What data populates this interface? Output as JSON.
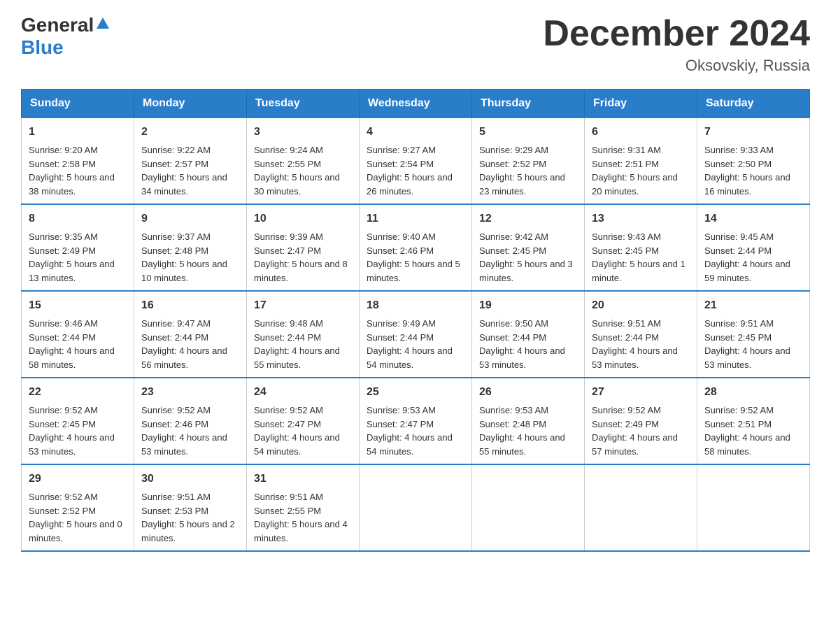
{
  "header": {
    "logo": {
      "general": "General",
      "blue": "Blue"
    },
    "title": "December 2024",
    "location": "Oksovskiy, Russia"
  },
  "weekdays": [
    "Sunday",
    "Monday",
    "Tuesday",
    "Wednesday",
    "Thursday",
    "Friday",
    "Saturday"
  ],
  "weeks": [
    [
      {
        "day": "1",
        "sunrise": "Sunrise: 9:20 AM",
        "sunset": "Sunset: 2:58 PM",
        "daylight": "Daylight: 5 hours and 38 minutes."
      },
      {
        "day": "2",
        "sunrise": "Sunrise: 9:22 AM",
        "sunset": "Sunset: 2:57 PM",
        "daylight": "Daylight: 5 hours and 34 minutes."
      },
      {
        "day": "3",
        "sunrise": "Sunrise: 9:24 AM",
        "sunset": "Sunset: 2:55 PM",
        "daylight": "Daylight: 5 hours and 30 minutes."
      },
      {
        "day": "4",
        "sunrise": "Sunrise: 9:27 AM",
        "sunset": "Sunset: 2:54 PM",
        "daylight": "Daylight: 5 hours and 26 minutes."
      },
      {
        "day": "5",
        "sunrise": "Sunrise: 9:29 AM",
        "sunset": "Sunset: 2:52 PM",
        "daylight": "Daylight: 5 hours and 23 minutes."
      },
      {
        "day": "6",
        "sunrise": "Sunrise: 9:31 AM",
        "sunset": "Sunset: 2:51 PM",
        "daylight": "Daylight: 5 hours and 20 minutes."
      },
      {
        "day": "7",
        "sunrise": "Sunrise: 9:33 AM",
        "sunset": "Sunset: 2:50 PM",
        "daylight": "Daylight: 5 hours and 16 minutes."
      }
    ],
    [
      {
        "day": "8",
        "sunrise": "Sunrise: 9:35 AM",
        "sunset": "Sunset: 2:49 PM",
        "daylight": "Daylight: 5 hours and 13 minutes."
      },
      {
        "day": "9",
        "sunrise": "Sunrise: 9:37 AM",
        "sunset": "Sunset: 2:48 PM",
        "daylight": "Daylight: 5 hours and 10 minutes."
      },
      {
        "day": "10",
        "sunrise": "Sunrise: 9:39 AM",
        "sunset": "Sunset: 2:47 PM",
        "daylight": "Daylight: 5 hours and 8 minutes."
      },
      {
        "day": "11",
        "sunrise": "Sunrise: 9:40 AM",
        "sunset": "Sunset: 2:46 PM",
        "daylight": "Daylight: 5 hours and 5 minutes."
      },
      {
        "day": "12",
        "sunrise": "Sunrise: 9:42 AM",
        "sunset": "Sunset: 2:45 PM",
        "daylight": "Daylight: 5 hours and 3 minutes."
      },
      {
        "day": "13",
        "sunrise": "Sunrise: 9:43 AM",
        "sunset": "Sunset: 2:45 PM",
        "daylight": "Daylight: 5 hours and 1 minute."
      },
      {
        "day": "14",
        "sunrise": "Sunrise: 9:45 AM",
        "sunset": "Sunset: 2:44 PM",
        "daylight": "Daylight: 4 hours and 59 minutes."
      }
    ],
    [
      {
        "day": "15",
        "sunrise": "Sunrise: 9:46 AM",
        "sunset": "Sunset: 2:44 PM",
        "daylight": "Daylight: 4 hours and 58 minutes."
      },
      {
        "day": "16",
        "sunrise": "Sunrise: 9:47 AM",
        "sunset": "Sunset: 2:44 PM",
        "daylight": "Daylight: 4 hours and 56 minutes."
      },
      {
        "day": "17",
        "sunrise": "Sunrise: 9:48 AM",
        "sunset": "Sunset: 2:44 PM",
        "daylight": "Daylight: 4 hours and 55 minutes."
      },
      {
        "day": "18",
        "sunrise": "Sunrise: 9:49 AM",
        "sunset": "Sunset: 2:44 PM",
        "daylight": "Daylight: 4 hours and 54 minutes."
      },
      {
        "day": "19",
        "sunrise": "Sunrise: 9:50 AM",
        "sunset": "Sunset: 2:44 PM",
        "daylight": "Daylight: 4 hours and 53 minutes."
      },
      {
        "day": "20",
        "sunrise": "Sunrise: 9:51 AM",
        "sunset": "Sunset: 2:44 PM",
        "daylight": "Daylight: 4 hours and 53 minutes."
      },
      {
        "day": "21",
        "sunrise": "Sunrise: 9:51 AM",
        "sunset": "Sunset: 2:45 PM",
        "daylight": "Daylight: 4 hours and 53 minutes."
      }
    ],
    [
      {
        "day": "22",
        "sunrise": "Sunrise: 9:52 AM",
        "sunset": "Sunset: 2:45 PM",
        "daylight": "Daylight: 4 hours and 53 minutes."
      },
      {
        "day": "23",
        "sunrise": "Sunrise: 9:52 AM",
        "sunset": "Sunset: 2:46 PM",
        "daylight": "Daylight: 4 hours and 53 minutes."
      },
      {
        "day": "24",
        "sunrise": "Sunrise: 9:52 AM",
        "sunset": "Sunset: 2:47 PM",
        "daylight": "Daylight: 4 hours and 54 minutes."
      },
      {
        "day": "25",
        "sunrise": "Sunrise: 9:53 AM",
        "sunset": "Sunset: 2:47 PM",
        "daylight": "Daylight: 4 hours and 54 minutes."
      },
      {
        "day": "26",
        "sunrise": "Sunrise: 9:53 AM",
        "sunset": "Sunset: 2:48 PM",
        "daylight": "Daylight: 4 hours and 55 minutes."
      },
      {
        "day": "27",
        "sunrise": "Sunrise: 9:52 AM",
        "sunset": "Sunset: 2:49 PM",
        "daylight": "Daylight: 4 hours and 57 minutes."
      },
      {
        "day": "28",
        "sunrise": "Sunrise: 9:52 AM",
        "sunset": "Sunset: 2:51 PM",
        "daylight": "Daylight: 4 hours and 58 minutes."
      }
    ],
    [
      {
        "day": "29",
        "sunrise": "Sunrise: 9:52 AM",
        "sunset": "Sunset: 2:52 PM",
        "daylight": "Daylight: 5 hours and 0 minutes."
      },
      {
        "day": "30",
        "sunrise": "Sunrise: 9:51 AM",
        "sunset": "Sunset: 2:53 PM",
        "daylight": "Daylight: 5 hours and 2 minutes."
      },
      {
        "day": "31",
        "sunrise": "Sunrise: 9:51 AM",
        "sunset": "Sunset: 2:55 PM",
        "daylight": "Daylight: 5 hours and 4 minutes."
      },
      null,
      null,
      null,
      null
    ]
  ]
}
